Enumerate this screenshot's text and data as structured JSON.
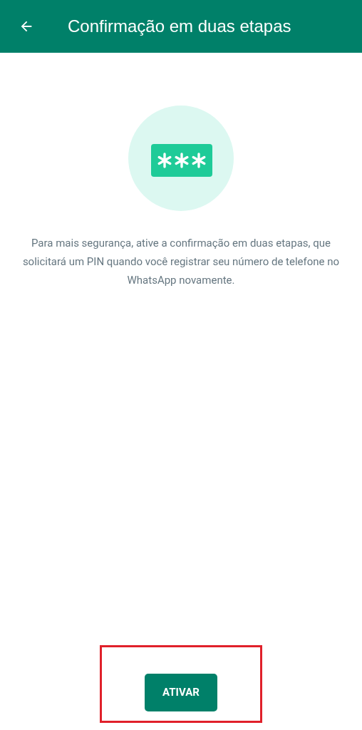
{
  "app_bar": {
    "title": "Confirmação em duas etapas"
  },
  "description": "Para mais segurança, ative a confirmação em duas etapas, que solicitará um PIN quando você registrar seu número de telefone no WhatsApp novamente.",
  "button": {
    "label": "ATIVAR",
    "highlighted": true
  }
}
